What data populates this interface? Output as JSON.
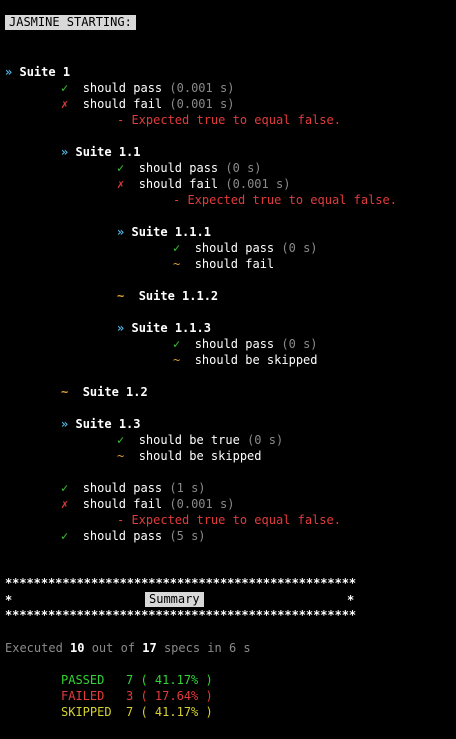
{
  "header_tag": "JASMINE STARTING:",
  "colors": {
    "pass": "#33cc33",
    "fail": "#e23b3b",
    "skip": "#e0a030",
    "suite": "#4cb6e6",
    "time": "#8a8a8a"
  },
  "symbols": {
    "suite": "»",
    "pass": "✓",
    "fail": "✗",
    "skip": "~"
  },
  "tree": {
    "suite1": "Suite 1",
    "s1_spec1": "should pass",
    "s1_spec1_time": "(0.001 s)",
    "s1_spec2": "should fail",
    "s1_spec2_time": "(0.001 s)",
    "s1_spec2_err": "- Expected true to equal false.",
    "suite1_1": "Suite 1.1",
    "s11_spec1": "should pass",
    "s11_spec1_time": "(0 s)",
    "s11_spec2": "should fail",
    "s11_spec2_time": "(0.001 s)",
    "s11_spec2_err": "- Expected true to equal false.",
    "suite1_1_1": "Suite 1.1.1",
    "s111_spec1": "should pass",
    "s111_spec1_time": "(0 s)",
    "s111_spec2": "should fail",
    "suite1_1_2": "Suite 1.1.2",
    "suite1_1_3": "Suite 1.1.3",
    "s113_spec1": "should pass",
    "s113_spec1_time": "(0 s)",
    "s113_spec2": "should be skipped",
    "suite1_2": "Suite 1.2",
    "suite1_3": "Suite 1.3",
    "s13_spec1": "should be true",
    "s13_spec1_time": "(0 s)",
    "s13_spec2": "should be skipped",
    "root_spec1": "should pass",
    "root_spec1_time": "(1 s)",
    "root_spec2": "should fail",
    "root_spec2_time": "(0.001 s)",
    "root_spec2_err": "- Expected true to equal false.",
    "root_spec3": "should pass",
    "root_spec3_time": "(5 s)"
  },
  "summary": {
    "stars": "*************************************************",
    "border_char": "*",
    "title": "Summary",
    "executed_prefix": "Executed ",
    "executed_count": "10",
    "executed_mid": " out of ",
    "total_count": "17",
    "executed_suffix": " specs in 6 s",
    "passed": "PASSED   7 ( 41.17% )",
    "failed": "FAILED   3 ( 17.64% )",
    "skipped": "SKIPPED  7 ( 41.17% )"
  }
}
